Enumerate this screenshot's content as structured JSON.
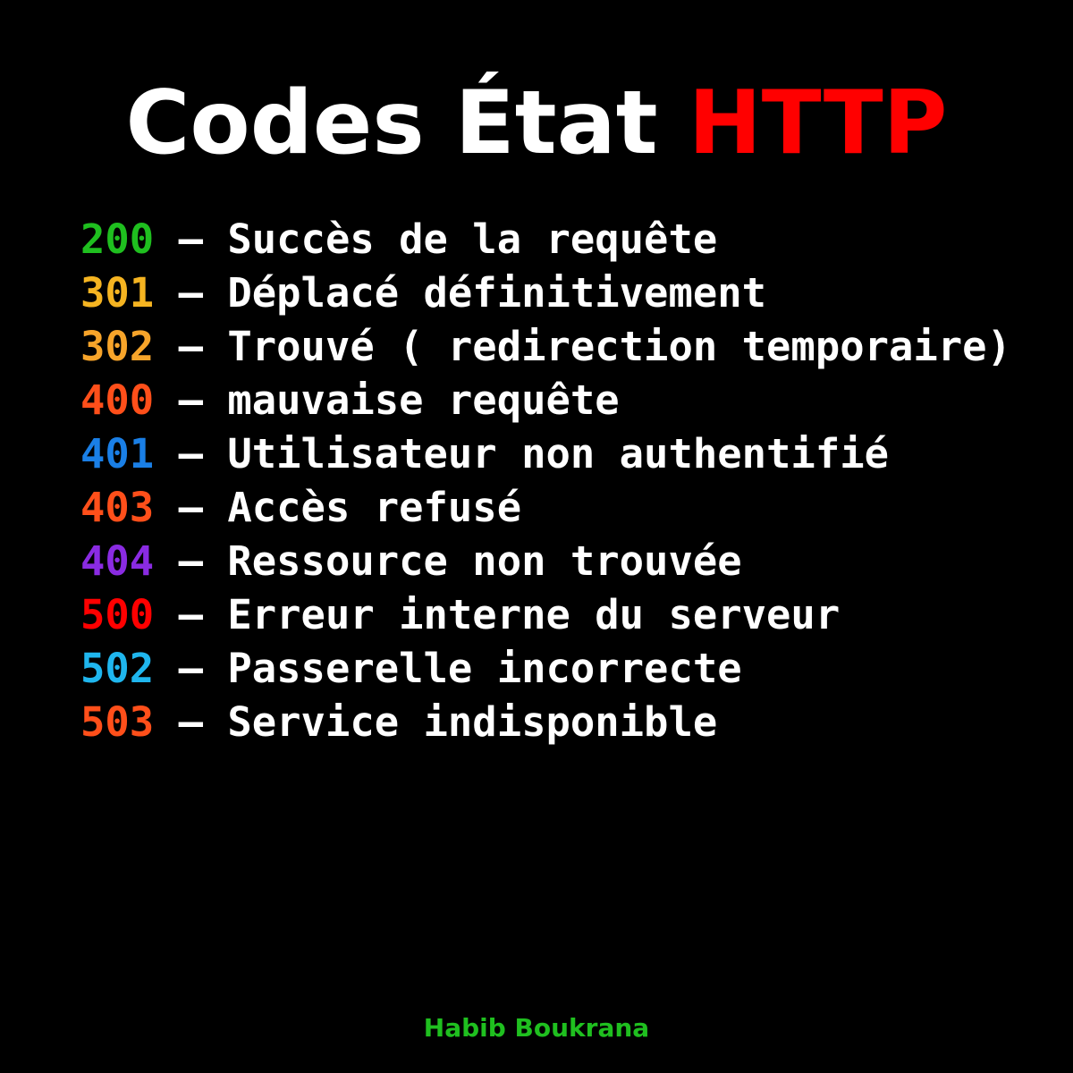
{
  "title": {
    "main": "Codes État",
    "accent": "HTTP",
    "accent_color": "#ff0000"
  },
  "codes": [
    {
      "code": "200",
      "separator": " – ",
      "description": "Succès de la requête",
      "color": "#1fbf1f"
    },
    {
      "code": "301",
      "separator": " – ",
      "description": "Déplacé définitivement",
      "color": "#f5b421"
    },
    {
      "code": "302",
      "separator": " – ",
      "description": "Trouvé ( redirection temporaire)",
      "color": "#f7a42a"
    },
    {
      "code": "400",
      "separator": " – ",
      "description": "mauvaise requête",
      "color": "#ff4f1a"
    },
    {
      "code": "401",
      "separator": " – ",
      "description": "Utilisateur non authentifié",
      "color": "#1a7fe6"
    },
    {
      "code": "403",
      "separator": " – ",
      "description": "Accès refusé",
      "color": "#ff4f1a"
    },
    {
      "code": "404",
      "separator": " – ",
      "description": "Ressource non trouvée",
      "color": "#8a2be2"
    },
    {
      "code": "500",
      "separator": " – ",
      "description": "Erreur interne du serveur",
      "color": "#ff0000"
    },
    {
      "code": "502",
      "separator": " – ",
      "description": "Passerelle incorrecte",
      "color": "#1fb6ee"
    },
    {
      "code": "503",
      "separator": " – ",
      "description": "Service indisponible",
      "color": "#ff4f1a"
    }
  ],
  "author": {
    "name": "Habib Boukrana",
    "color": "#1fbf1f"
  }
}
